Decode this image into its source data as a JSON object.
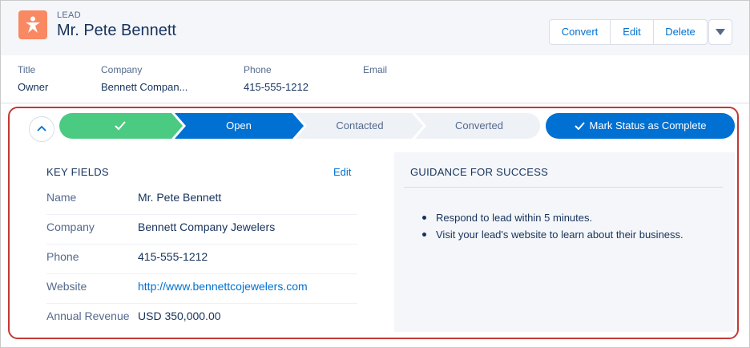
{
  "header": {
    "record_type": "LEAD",
    "record_name": "Mr. Pete Bennett",
    "icon": "lead-person-icon",
    "icon_color": "#f88962",
    "actions": {
      "convert": "Convert",
      "edit": "Edit",
      "delete": "Delete"
    }
  },
  "highlights": {
    "title": {
      "label": "Title",
      "value": "Owner"
    },
    "company": {
      "label": "Company",
      "value": "Bennett Compan..."
    },
    "phone": {
      "label": "Phone",
      "value": "415-555-1212"
    },
    "email": {
      "label": "Email",
      "value": ""
    }
  },
  "path": {
    "stages": [
      "",
      "Open",
      "Contacted",
      "Converted"
    ],
    "completed_color": "#4bca81",
    "current_color": "#0070d2",
    "incomplete_color": "#eef1f6",
    "mark_complete_label": "Mark Status as Complete"
  },
  "key_fields": {
    "title": "KEY FIELDS",
    "edit_label": "Edit",
    "rows": [
      {
        "label": "Name",
        "value": "Mr. Pete Bennett"
      },
      {
        "label": "Company",
        "value": "Bennett Company Jewelers"
      },
      {
        "label": "Phone",
        "value": "415-555-1212"
      },
      {
        "label": "Website",
        "value": "http://www.bennettcojewelers.com"
      },
      {
        "label": "Annual Revenue",
        "value": "USD 350,000.00"
      }
    ]
  },
  "guidance": {
    "title": "GUIDANCE FOR SUCCESS",
    "items": [
      "Respond to lead within 5 minutes.",
      "Visit your lead's website to learn about their business."
    ]
  },
  "highlight_border_color": "#c23934"
}
